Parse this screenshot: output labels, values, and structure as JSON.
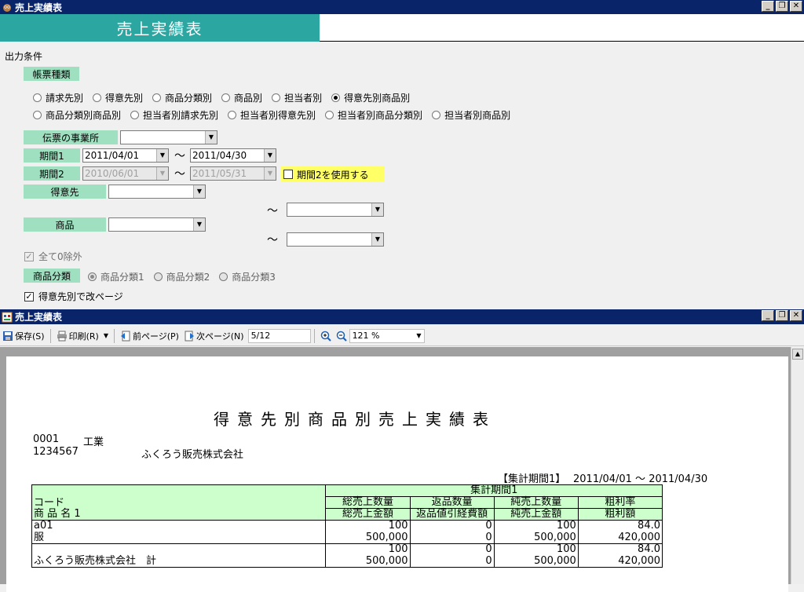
{
  "main_window": {
    "title": "売上実績表",
    "banner": "売上実績表",
    "section_label": "出力条件",
    "report_type_label": "帳票種類",
    "report_types": [
      {
        "label": "請求先別",
        "checked": false
      },
      {
        "label": "得意先別",
        "checked": false
      },
      {
        "label": "商品分類別",
        "checked": false
      },
      {
        "label": "商品別",
        "checked": false
      },
      {
        "label": "担当者別",
        "checked": false
      },
      {
        "label": "得意先別商品別",
        "checked": true
      },
      {
        "label": "商品分類別商品別",
        "checked": false
      },
      {
        "label": "担当者別請求先別",
        "checked": false
      },
      {
        "label": "担当者別得意先別",
        "checked": false
      },
      {
        "label": "担当者別商品分類別",
        "checked": false
      },
      {
        "label": "担当者別商品別",
        "checked": false
      }
    ],
    "office_label": "伝票の事業所",
    "office_value": "",
    "period1_label": "期間1",
    "period1_from": "2011/04/01",
    "period1_to": "2011/04/30",
    "period2_label": "期間2",
    "period2_from": "2010/06/01",
    "period2_to": "2011/05/31",
    "use_period2_label": "期間2を使用する",
    "tilde": "～",
    "customer_label": "得意先",
    "product_label": "商品",
    "exclude_zero_label": "全て0除外",
    "category_label": "商品分類",
    "categories": [
      {
        "label": "商品分類1",
        "checked": true
      },
      {
        "label": "商品分類2",
        "checked": false
      },
      {
        "label": "商品分類3",
        "checked": false
      }
    ],
    "page_break_label": "得意先別で改ページ"
  },
  "report_window": {
    "title": "売上実績表",
    "toolbar": {
      "save": "保存(S)",
      "print": "印刷(R)",
      "prev_page": "前ページ(P)",
      "next_page": "次ページ(N)",
      "page_value": "5/12",
      "zoom_value": "121 %"
    },
    "report": {
      "title": "得意先別商品別売上実績表",
      "code_line": "0001",
      "code_name": "工業",
      "customer_code": "1234567",
      "customer_name": "ふくろう販売株式会社",
      "period_caption": "【集計期間1】",
      "period_range": "2011/04/01 ～ 2011/04/30",
      "group_header": "集計期間1",
      "col_code": "コード",
      "col_name": "商 品 名 1",
      "col_h1a": "総売上数量",
      "col_h1b": "総売上金額",
      "col_h2a": "返品数量",
      "col_h2b": "返品値引経費額",
      "col_h3a": "純売上数量",
      "col_h3b": "純売上金額",
      "col_h4a": "粗利率",
      "col_h4b": "粗利額",
      "row1": {
        "code": "a01",
        "name": "服",
        "qty": "100",
        "amt": "500,000",
        "ret_qty": "0",
        "ret_amt": "0",
        "net_qty": "100",
        "net_amt": "500,000",
        "margin_rate": "84.0",
        "margin_amt": "420,000"
      },
      "total": {
        "label": "ふくろう販売株式会社　計",
        "qty": "100",
        "amt": "500,000",
        "ret_qty": "0",
        "ret_amt": "0",
        "net_qty": "100",
        "net_amt": "500,000",
        "margin_rate": "84.0",
        "margin_amt": "420,000"
      }
    }
  }
}
